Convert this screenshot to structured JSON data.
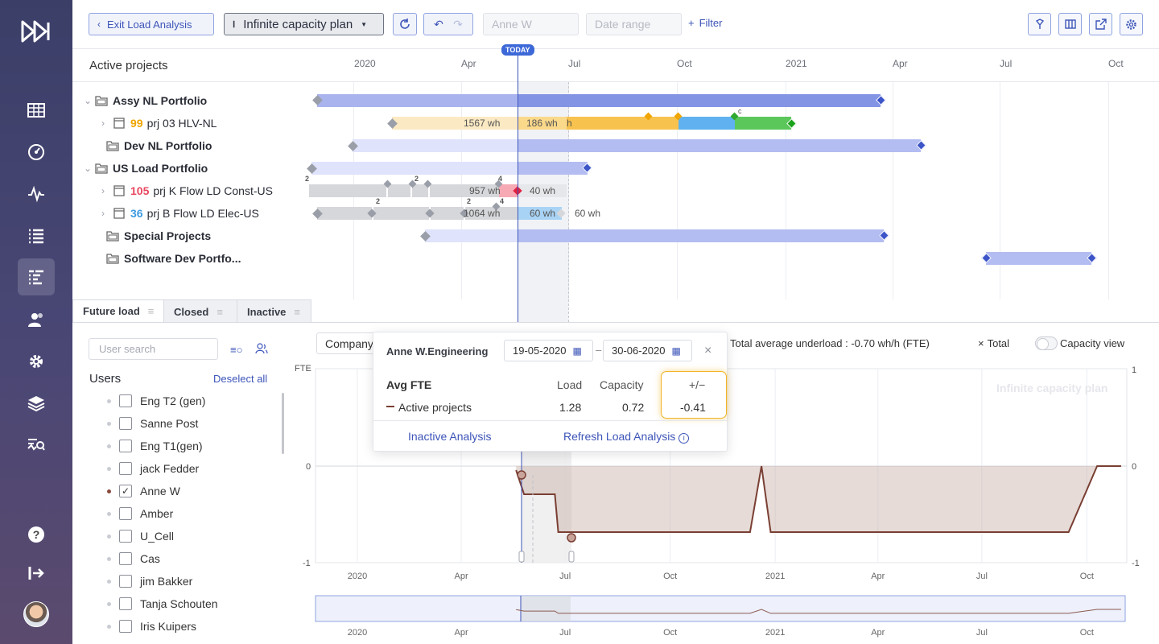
{
  "toolbar": {
    "exit_label": "Exit Load Analysis",
    "plan_label": "Infinite capacity plan",
    "user_input": "Anne W",
    "date_placeholder": "Date range",
    "filter_label": "Filter"
  },
  "gantt": {
    "title": "Active projects",
    "today_label": "TODAY",
    "ticks": [
      "2020",
      "Apr",
      "Jul",
      "Oct",
      "2021",
      "Apr",
      "Jul",
      "Oct"
    ],
    "rows": [
      {
        "label": "Assy NL Portfolio"
      },
      {
        "num": "99",
        "label": "prj 03 HLV-NL",
        "wh1": "1567 wh",
        "wh2": "186 wh",
        "wh2b": "h"
      },
      {
        "label": "Dev NL Portfolio"
      },
      {
        "label": "US Load Portfolio"
      },
      {
        "num": "105",
        "label": "prj K Flow LD Const-US",
        "wh1": "957 wh",
        "wh2": "40 wh"
      },
      {
        "num": "36",
        "label": "prj B Flow LD Elec-US",
        "wh1": "1064 wh",
        "wh2": "60 wh",
        "wh3": "60 wh"
      },
      {
        "label": "Special Projects"
      },
      {
        "label": "Software Dev Portfo..."
      }
    ],
    "marker_labels": {
      "c": "c",
      "two": "2",
      "four": "4"
    }
  },
  "tabs": [
    "Future load",
    "Closed",
    "Inactive"
  ],
  "users": {
    "search_placeholder": "User search",
    "title": "Users",
    "deselect_label": "Deselect all",
    "list": [
      "Eng T2 (gen)",
      "Sanne Post",
      "Eng T1(gen)",
      "jack Fedder",
      "Anne W",
      "Amber",
      "U_Cell",
      "Cas",
      "jim Bakker",
      "Tanja Schouten",
      "Iris Kuipers"
    ],
    "selected": "Anne W"
  },
  "chart": {
    "company_label": "Company",
    "underload_text": "Total average underload : -0.70 wh/h (FTE)",
    "total_label": "Total",
    "capacity_view_label": "Capacity view",
    "y_axis_label": "FTE",
    "watermark": "Infinite capacity plan",
    "left_ticks": [
      "0",
      "-1"
    ],
    "right_ticks": [
      "1",
      "0",
      "-1"
    ],
    "x_ticks": [
      "2020",
      "Apr",
      "Jul",
      "Oct",
      "2021",
      "Apr",
      "Jul",
      "Oct"
    ]
  },
  "chart_data": {
    "type": "area",
    "title": "",
    "ylabel": "FTE",
    "ylim": [
      -1,
      1
    ],
    "series": [
      {
        "name": "Active projects",
        "color": "#7a3f33"
      }
    ],
    "x": [
      "2020-05-19",
      "2020-05-26",
      "2020-06-22",
      "2020-06-25",
      "2020-06-30",
      "2020-12-10",
      "2020-12-20",
      "2020-12-28",
      "2021-09-15",
      "2021-10-10",
      "2021-10-31"
    ],
    "y": [
      -0.05,
      -0.35,
      -0.35,
      -0.82,
      -0.82,
      -0.82,
      0.0,
      -0.82,
      -0.82,
      0.0,
      0.0
    ]
  },
  "popover": {
    "user": "Anne W.Engineering",
    "date_from": "19-05-2020",
    "date_sep": "–",
    "date_to": "30-06-2020",
    "close": "×",
    "col_title": "Avg FTE",
    "col_load": "Load",
    "col_capacity": "Capacity",
    "col_diff": "+/−",
    "row_label": "Active projects",
    "load": "1.28",
    "capacity": "0.72",
    "diff": "-0.41",
    "inactive_link": "Inactive Analysis",
    "refresh_link": "Refresh Load Analysis",
    "info": "i"
  },
  "colors": {
    "accent": "#3d55b8",
    "rail": "#3f4270",
    "bar_blue": "#8fa0e8",
    "bar_pale": "#dfe3fb"
  }
}
